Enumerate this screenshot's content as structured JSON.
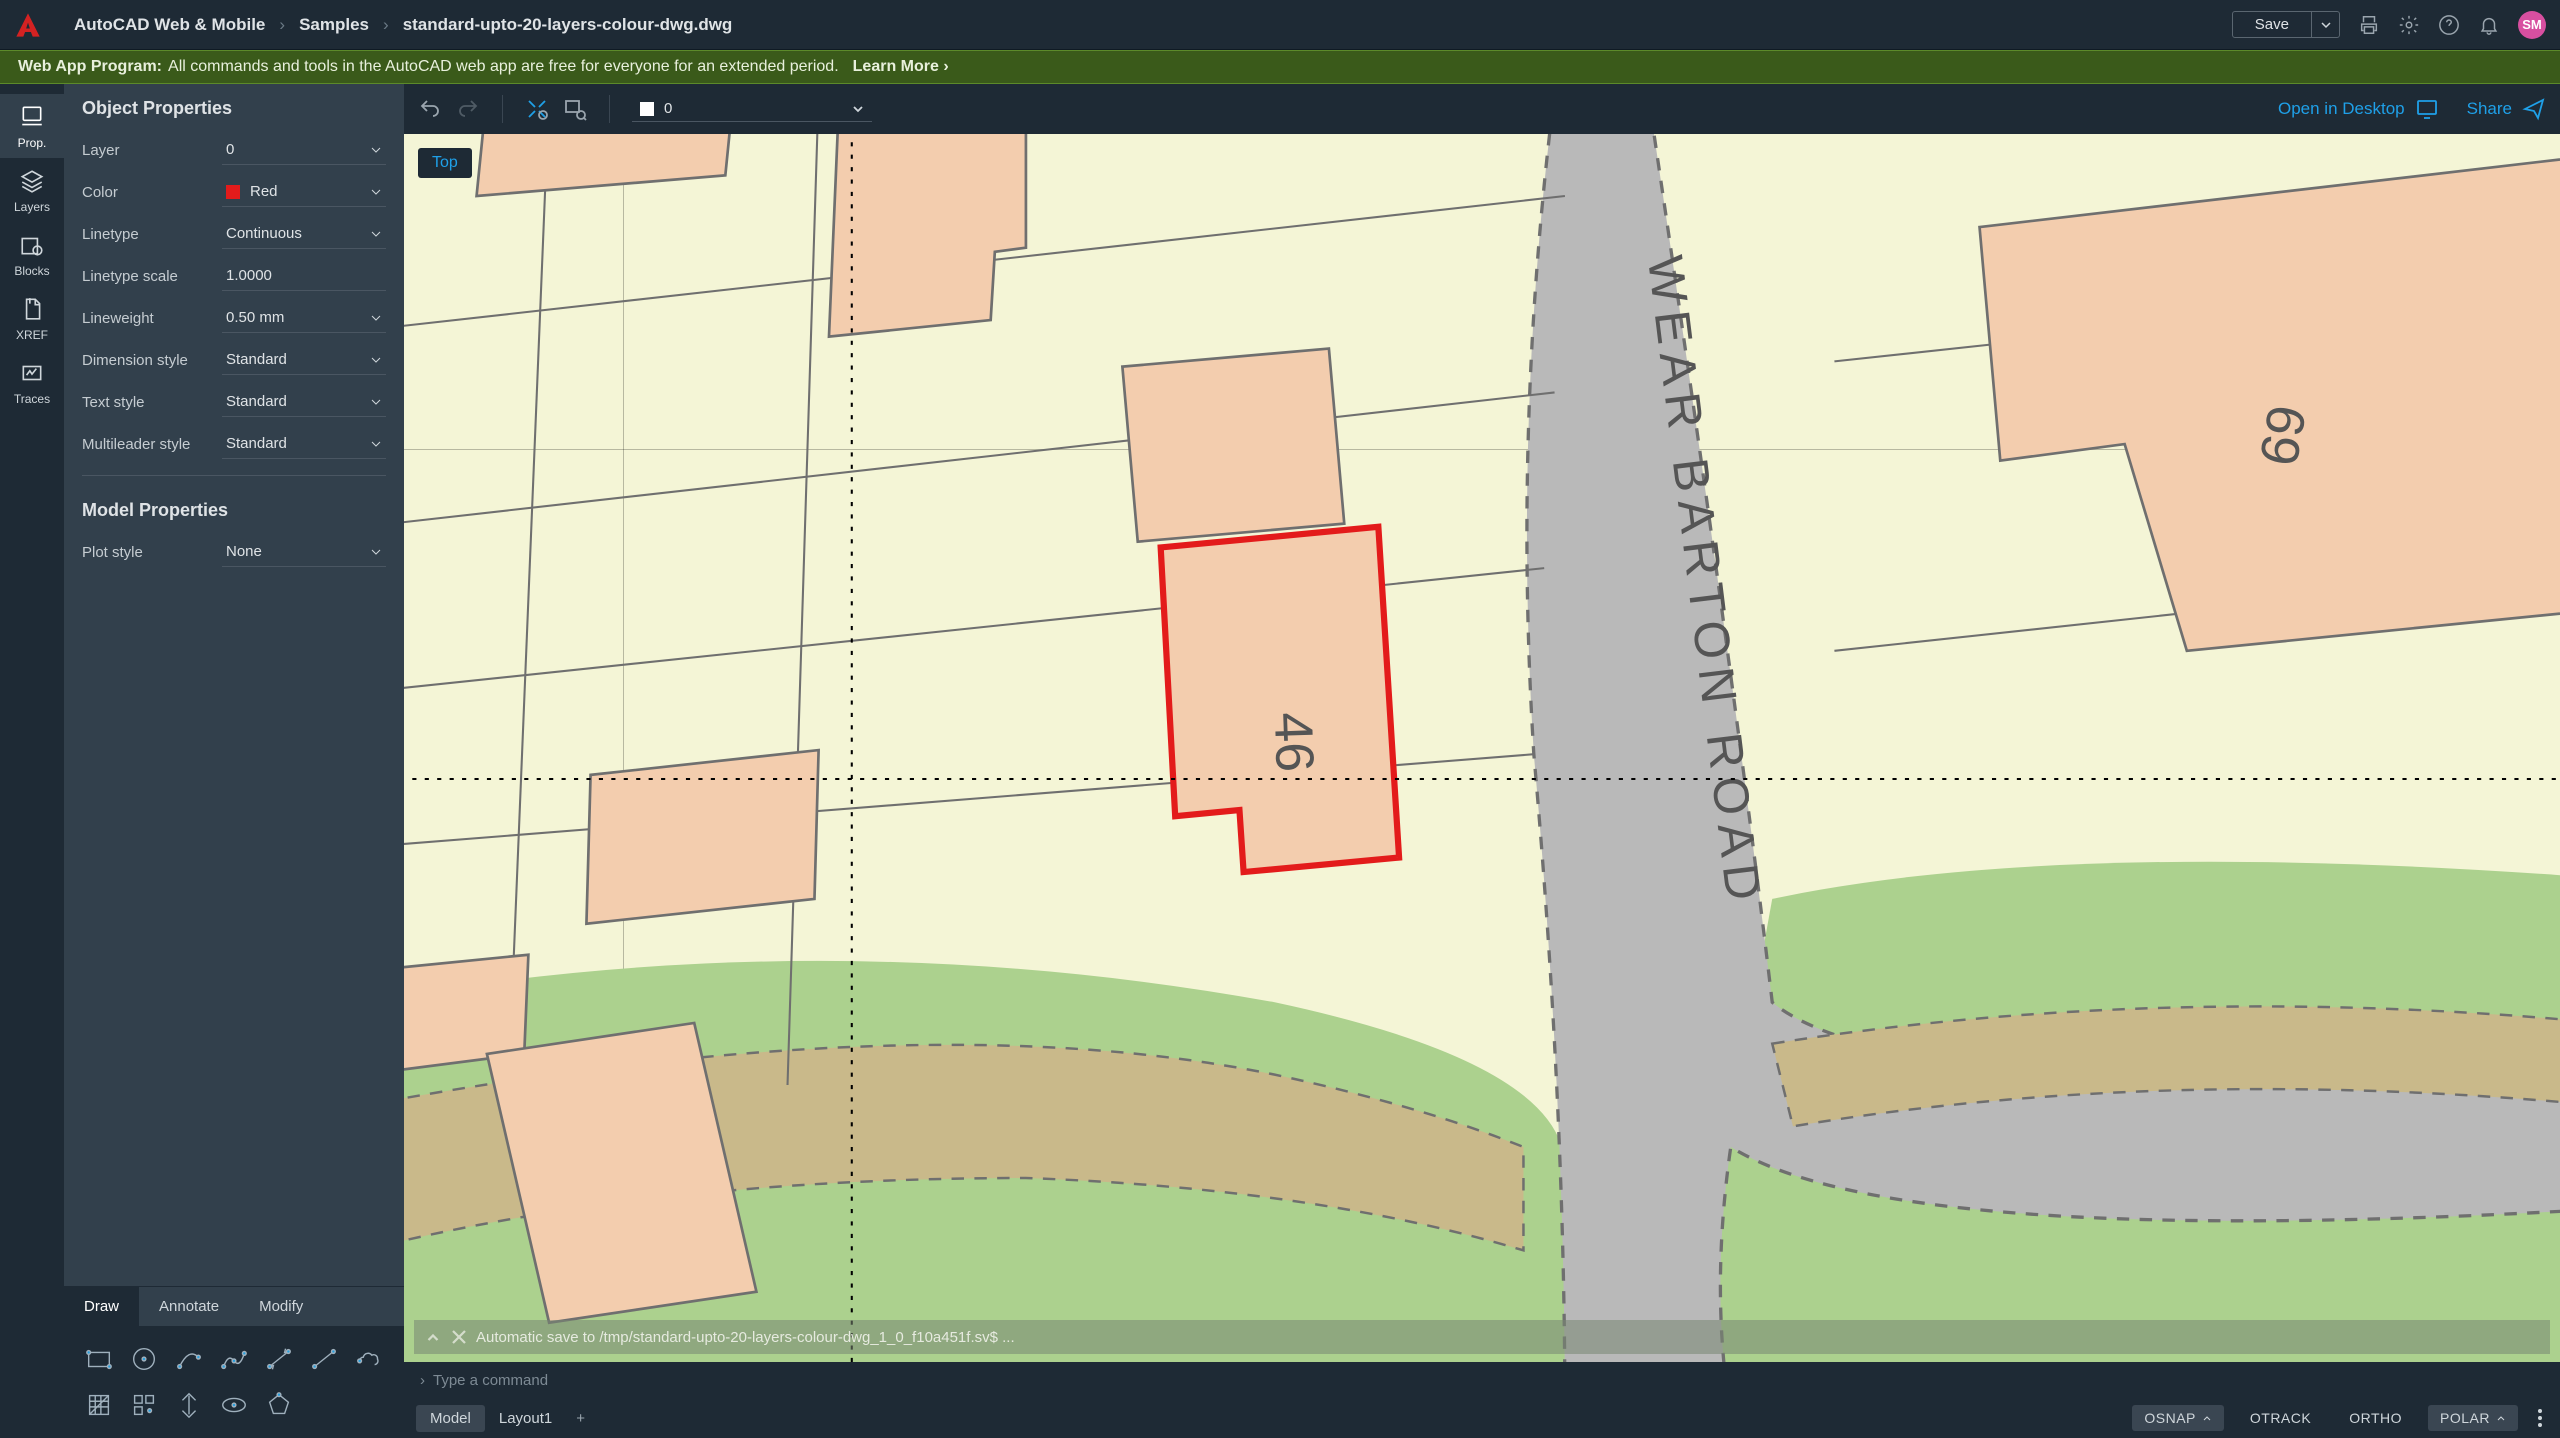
{
  "header": {
    "breadcrumb": [
      "AutoCAD Web & Mobile",
      "Samples",
      "standard-upto-20-layers-colour-dwg.dwg"
    ],
    "save_label": "Save",
    "avatar_initials": "SM"
  },
  "promo": {
    "title": "Web App Program:",
    "body": "All commands and tools in the AutoCAD web app are free for everyone for an extended period.",
    "learn_more": "Learn More"
  },
  "nav": {
    "items": [
      "Prop.",
      "Layers",
      "Blocks",
      "XREF",
      "Traces"
    ],
    "active_index": 0
  },
  "props": {
    "section1_title": "Object Properties",
    "section2_title": "Model Properties",
    "rows": {
      "layer": {
        "label": "Layer",
        "value": "0"
      },
      "color": {
        "label": "Color",
        "value": "Red",
        "swatch": "#e31b1b"
      },
      "linetype": {
        "label": "Linetype",
        "value": "Continuous"
      },
      "linetype_scale": {
        "label": "Linetype scale",
        "value": "1.0000"
      },
      "lineweight": {
        "label": "Lineweight",
        "value": "0.50 mm"
      },
      "dimension_style": {
        "label": "Dimension style",
        "value": "Standard"
      },
      "text_style": {
        "label": "Text style",
        "value": "Standard"
      },
      "multileader_style": {
        "label": "Multileader style",
        "value": "Standard"
      },
      "plot_style": {
        "label": "Plot style",
        "value": "None"
      }
    }
  },
  "tool_tabs": {
    "tabs": [
      "Draw",
      "Annotate",
      "Modify"
    ],
    "active_index": 0
  },
  "draw_tools": [
    "rectangle",
    "circle",
    "arc",
    "polyline",
    "dimension-line",
    "line",
    "revcloud",
    "hatch",
    "array",
    "point-style",
    "ellipse",
    "polygon"
  ],
  "canvas": {
    "undo_redo": true,
    "layer_selector_value": "0",
    "open_in_desktop": "Open in Desktop",
    "share": "Share",
    "top_badge": "Top",
    "map_text": {
      "road": "WEAR BARTON ROAD",
      "plot46": "46",
      "plot69": "69"
    },
    "autosave_msg": "Automatic save to /tmp/standard-upto-20-layers-colour-dwg_1_0_f10a451f.sv$ ..."
  },
  "colors": {
    "accent": "#1fa0e8",
    "selected": "#e31b1b"
  },
  "commandline": {
    "placeholder": "Type a command"
  },
  "statusbar": {
    "tabs": [
      "Model",
      "Layout1"
    ],
    "active_tab_index": 0,
    "toggles": [
      {
        "label": "OSNAP",
        "active": true,
        "caret": true
      },
      {
        "label": "OTRACK",
        "active": false,
        "caret": false
      },
      {
        "label": "ORTHO",
        "active": false,
        "caret": false
      },
      {
        "label": "POLAR",
        "active": true,
        "caret": true
      }
    ]
  }
}
